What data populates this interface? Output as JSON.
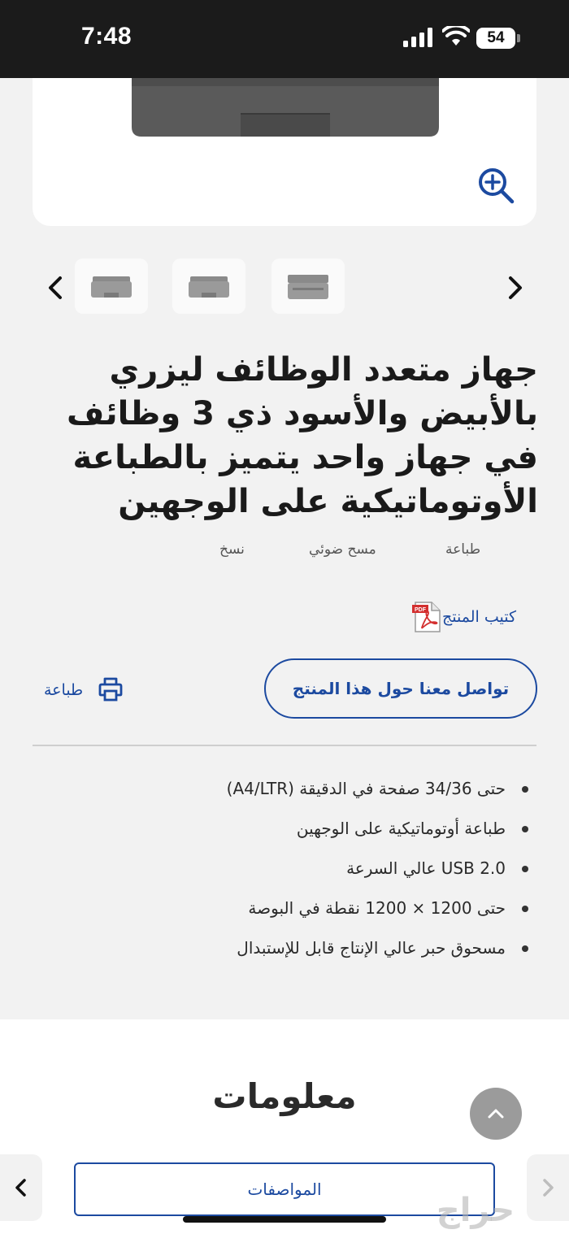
{
  "status_bar": {
    "time": "7:48",
    "battery": "54"
  },
  "product": {
    "title": "جهاز متعدد الوظائف ليزري بالأبيض والأسود ذي 3 وظائف في جهاز واحد يتميز بالطباعة الأوتوماتيكية على الوجهين",
    "tags": [
      "طباعة",
      "مسح ضوئي",
      "نسخ"
    ],
    "manual_label": "كتيب المنتج",
    "contact_label": "تواصل معنا حول هذا المنتج",
    "print_label": "طباعة",
    "specs": [
      "حتى 34/36 صفحة في الدقيقة (A4/LTR)",
      "طباعة أوتوماتيكية على الوجهين",
      "USB 2.0 عالي السرعة",
      "حتى 1200 × 1200 نقطة في البوصة",
      "مسحوق حبر عالي الإنتاج قابل للإستبدال"
    ]
  },
  "info": {
    "heading": "معلومات",
    "tab_label": "المواصفات"
  },
  "watermark": "حراج",
  "icons": [
    "signal-icon",
    "wifi-icon",
    "zoom-in-icon",
    "chevron-left-icon",
    "chevron-right-icon",
    "pdf-icon",
    "printer-icon",
    "chevron-up-icon"
  ],
  "colors": {
    "accent": "#1c4aa0",
    "status_bar": "#1b1b1b",
    "page_bg": "#f2f2f2"
  }
}
